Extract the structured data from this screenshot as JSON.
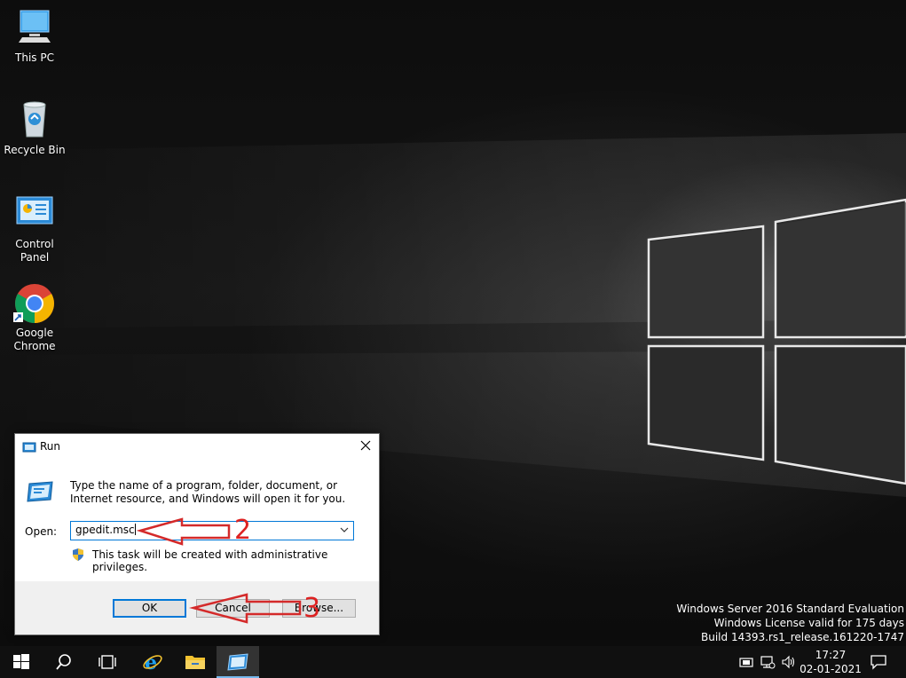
{
  "desktop": {
    "icons": [
      {
        "label": "This PC",
        "icon": "this-pc-icon"
      },
      {
        "label": "Recycle Bin",
        "icon": "recycle-bin-icon"
      },
      {
        "label": "Control Panel",
        "icon": "control-panel-icon"
      },
      {
        "label": "Google Chrome",
        "icon": "chrome-icon"
      }
    ]
  },
  "run_dialog": {
    "title": "Run",
    "description": "Type the name of a program, folder, document, or Internet resource, and Windows will open it for you.",
    "open_label": "Open:",
    "open_value": "gpedit.msc",
    "admin_note": "This task will be created with administrative privileges.",
    "ok_label": "OK",
    "cancel_label": "Cancel",
    "browse_label": "Browse..."
  },
  "annotations": {
    "step2": "2",
    "step3": "3",
    "color": "#d42a2a"
  },
  "watermark": {
    "line1": "Windows Server 2016 Standard Evaluation",
    "line2": "Windows License valid for 175 days",
    "line3": "Build 14393.rs1_release.161220-1747"
  },
  "taskbar": {
    "apps": [
      "start-icon",
      "search-icon",
      "task-view-icon",
      "internet-explorer-icon",
      "file-explorer-icon",
      "run-icon"
    ],
    "tray": [
      "action-center-flag-icon",
      "network-icon",
      "volume-icon"
    ],
    "time": "17:27",
    "date": "02-01-2021"
  },
  "colors": {
    "accent": "#0078d7",
    "taskbar": "#101010"
  }
}
